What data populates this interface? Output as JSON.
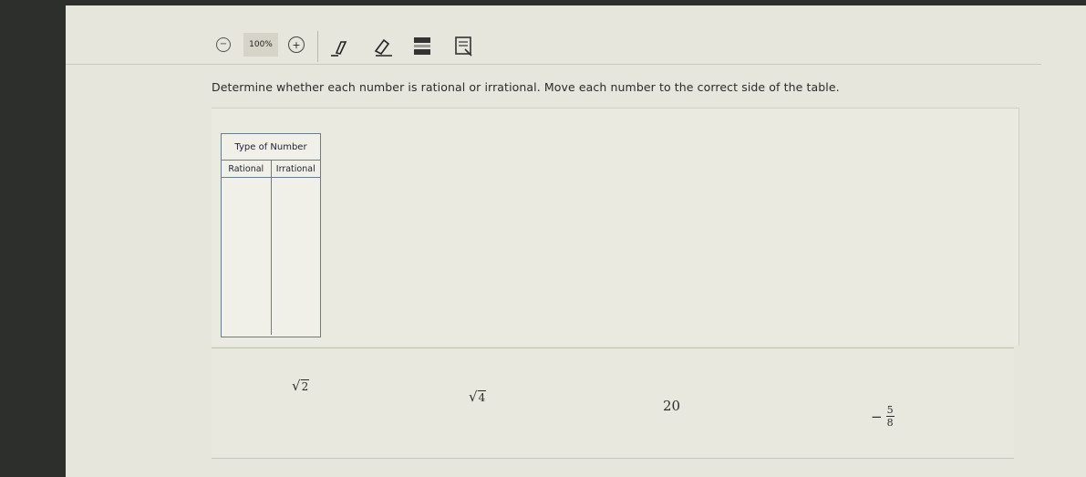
{
  "toolbar": {
    "zoom_out_symbol": "−",
    "zoom_level": "100%",
    "zoom_in_symbol": "+"
  },
  "instructions": "Determine whether each number is rational or irrational. Move each number to the correct side of the table.",
  "table": {
    "title": "Type of Number",
    "columns": [
      "Rational",
      "Irrational"
    ]
  },
  "tiles": [
    {
      "radical": "√",
      "radicand": "2"
    },
    {
      "radical": "√",
      "radicand": "4"
    },
    {
      "value": "20"
    },
    {
      "sign": "−",
      "numerator": "5",
      "denominator": "8"
    }
  ]
}
